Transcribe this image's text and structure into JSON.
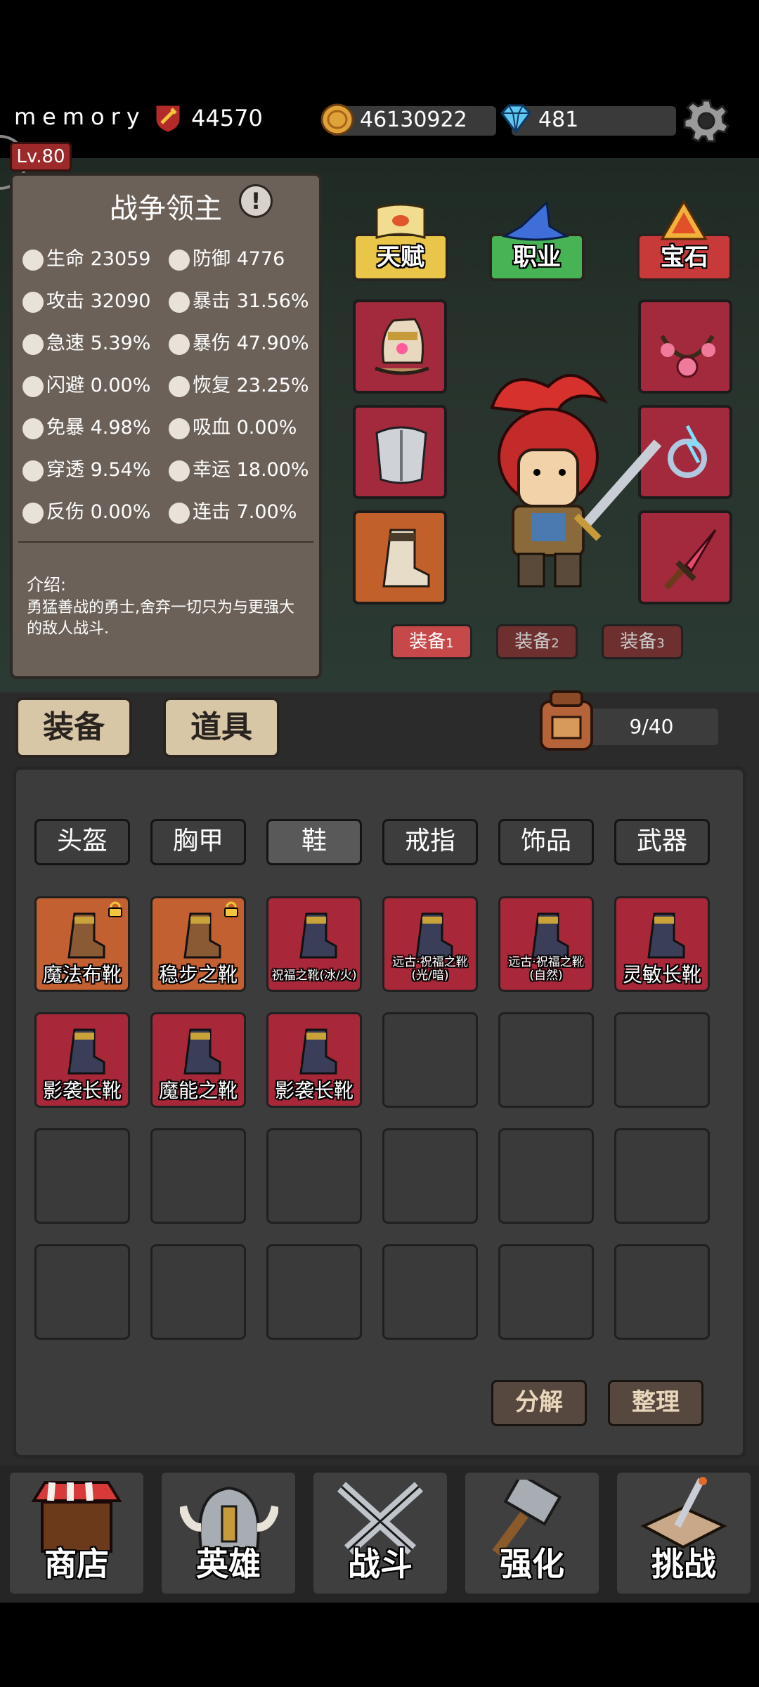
{
  "top": {
    "username": "memory",
    "power": "44570",
    "gold": "46130922",
    "gems": "481",
    "level": "Lv.80"
  },
  "hero": {
    "title": "战争领主",
    "stats": [
      {
        "icon": "heart-icon",
        "label": "生命",
        "value": "23059"
      },
      {
        "icon": "shield-icon",
        "label": "防御",
        "value": "4776"
      },
      {
        "icon": "sword-icon",
        "label": "攻击",
        "value": "32090"
      },
      {
        "icon": "flame-icon",
        "label": "暴击",
        "value": "31.56%"
      },
      {
        "icon": "haste-icon",
        "label": "急速",
        "value": "5.39%"
      },
      {
        "icon": "crit-damage-icon",
        "label": "暴伤",
        "value": "47.90%"
      },
      {
        "icon": "dodge-icon",
        "label": "闪避",
        "value": "0.00%"
      },
      {
        "icon": "regen-icon",
        "label": "恢复",
        "value": "23.25%"
      },
      {
        "icon": "crit-immune-icon",
        "label": "免暴",
        "value": "4.98%"
      },
      {
        "icon": "lifesteal-icon",
        "label": "吸血",
        "value": "0.00%"
      },
      {
        "icon": "pierce-icon",
        "label": "穿透",
        "value": "9.54%"
      },
      {
        "icon": "clover-icon",
        "label": "幸运",
        "value": "18.00%"
      },
      {
        "icon": "thorns-icon",
        "label": "反伤",
        "value": "0.00%"
      },
      {
        "icon": "combo-icon",
        "label": "连击",
        "value": "7.00%"
      }
    ],
    "intro_label": "介绍:",
    "intro_text": "勇猛善战的勇士,舍弃一切只为与更强大的敌人战斗."
  },
  "hero_tabs": {
    "talent": "天赋",
    "job": "职业",
    "gem": "宝石"
  },
  "loadouts": [
    {
      "label": "装备",
      "num": "1"
    },
    {
      "label": "装备",
      "num": "2"
    },
    {
      "label": "装备",
      "num": "3"
    }
  ],
  "section_tabs": {
    "equip": "装备",
    "items": "道具"
  },
  "bag": {
    "count": "9/40"
  },
  "categories": [
    "头盔",
    "胸甲",
    "鞋",
    "戒指",
    "饰品",
    "武器"
  ],
  "inventory": [
    {
      "name": "魔法布靴",
      "rarity": "orange",
      "locked": true
    },
    {
      "name": "稳步之靴",
      "rarity": "orange",
      "locked": true
    },
    {
      "name": "祝福之靴(冰/火)",
      "rarity": "red",
      "locked": false
    },
    {
      "name": "远古·祝福之靴(光/暗)",
      "rarity": "red",
      "locked": false
    },
    {
      "name": "远古·祝福之靴(自然)",
      "rarity": "red",
      "locked": false
    },
    {
      "name": "灵敏长靴",
      "rarity": "red",
      "locked": false
    },
    {
      "name": "影袭长靴",
      "rarity": "red",
      "locked": false
    },
    {
      "name": "魔能之靴",
      "rarity": "red",
      "locked": false
    },
    {
      "name": "影袭长靴",
      "rarity": "red",
      "locked": false
    }
  ],
  "actions": {
    "decompose": "分解",
    "sort": "整理"
  },
  "nav": [
    "商店",
    "英雄",
    "战斗",
    "强化",
    "挑战"
  ],
  "colors": {
    "red_rarity": "#a8283a",
    "orange_rarity": "#c26031",
    "gold": "#e0a33a",
    "gem": "#5ec8f0"
  }
}
